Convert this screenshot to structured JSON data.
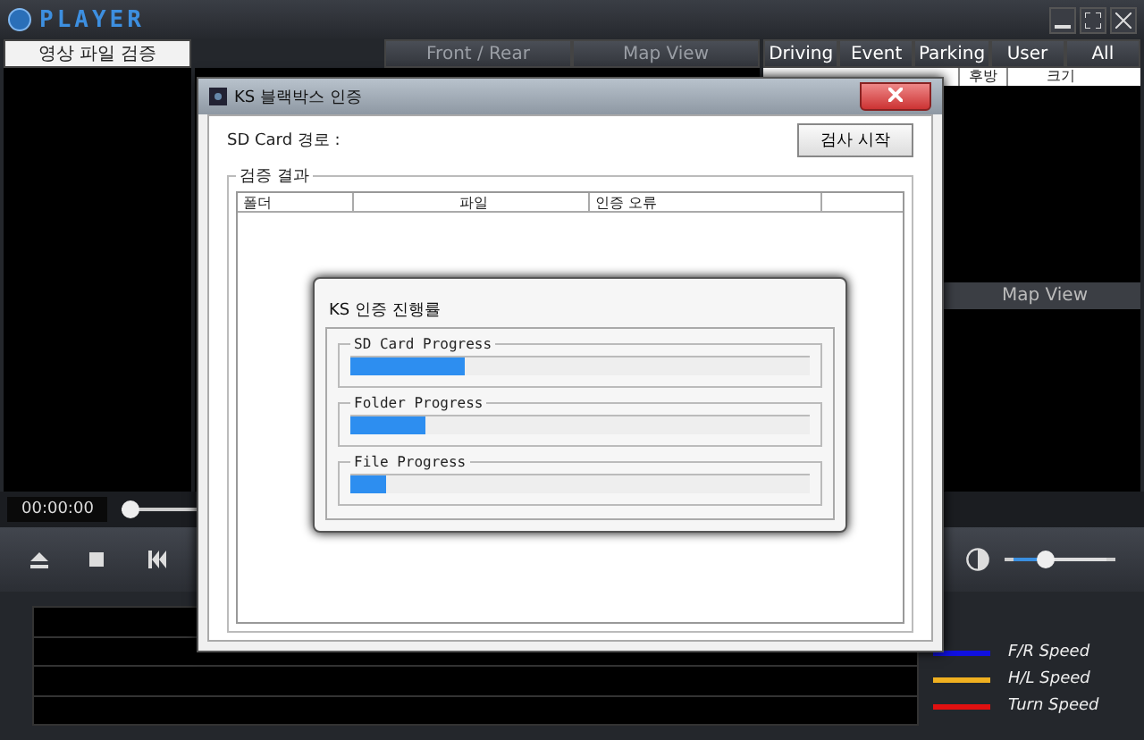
{
  "app": {
    "logo": "PLAYER"
  },
  "left_tab": {
    "label": "영상 파일 검증",
    "selected": true
  },
  "view_tabs": [
    {
      "label": "Front / Rear",
      "selected": false
    },
    {
      "label": "Map View",
      "selected": false
    }
  ],
  "filter_tabs": [
    {
      "label": "Driving",
      "selected": false
    },
    {
      "label": "Event",
      "selected": false
    },
    {
      "label": "Parking",
      "selected": false
    },
    {
      "label": "User",
      "selected": false
    },
    {
      "label": "All",
      "selected": false
    }
  ],
  "file_table": {
    "columns": [
      "후방",
      "크기"
    ]
  },
  "map_panel": {
    "title": "Map View"
  },
  "playback": {
    "time": "00:00:00",
    "level": 0.0
  },
  "contrast": {
    "level": 0.35
  },
  "legend": [
    {
      "label": "F/R Speed",
      "color": "#1010e0"
    },
    {
      "label": "H/L Speed",
      "color": "#f0b020"
    },
    {
      "label": "Turn Speed",
      "color": "#e01010"
    }
  ],
  "dialog": {
    "title": "KS 블랙박스 인증",
    "path_label": "SD Card 경로 :",
    "start_button": "검사 시작",
    "group_title": "검증 결과",
    "columns": [
      "폴더",
      "파일",
      "인증 오류"
    ]
  },
  "progress_dialog": {
    "title": "KS 인증 진행률",
    "bars": [
      {
        "label": "SD Card Progress",
        "level": 0.25
      },
      {
        "label": "Folder Progress",
        "level": 0.165
      },
      {
        "label": "File Progress",
        "level": 0.076
      }
    ]
  }
}
